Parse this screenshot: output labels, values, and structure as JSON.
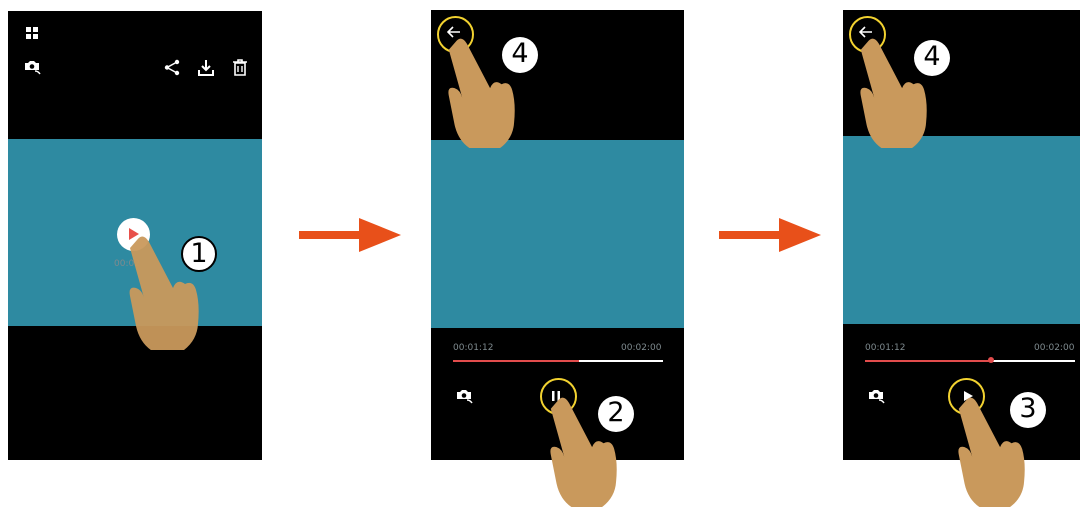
{
  "colors": {
    "video": "#2e8aa1",
    "screen_bg": "#000000",
    "progress": "#e24c4c",
    "arrow": "#e8501a",
    "highlight_ring": "#f2d230",
    "hand": "#c9995c",
    "play_icon": "#e8504a"
  },
  "screen1": {
    "step": "1",
    "time_text": "00:02",
    "icons": [
      "grid-icon",
      "camera-switch-icon",
      "share-icon",
      "download-icon",
      "delete-icon",
      "play-button"
    ]
  },
  "screen2": {
    "step_a": "2",
    "step_b": "4",
    "elapsed": "00:01:12",
    "total": "00:02:00",
    "progress": 0.6,
    "icons": [
      "back-icon",
      "camera-switch-icon",
      "pause-icon"
    ]
  },
  "screen3": {
    "step_a": "3",
    "step_b": "4",
    "elapsed": "00:01:12",
    "total": "00:02:00",
    "progress": 0.6,
    "icons": [
      "back-icon",
      "camera-switch-icon",
      "play-icon"
    ]
  }
}
